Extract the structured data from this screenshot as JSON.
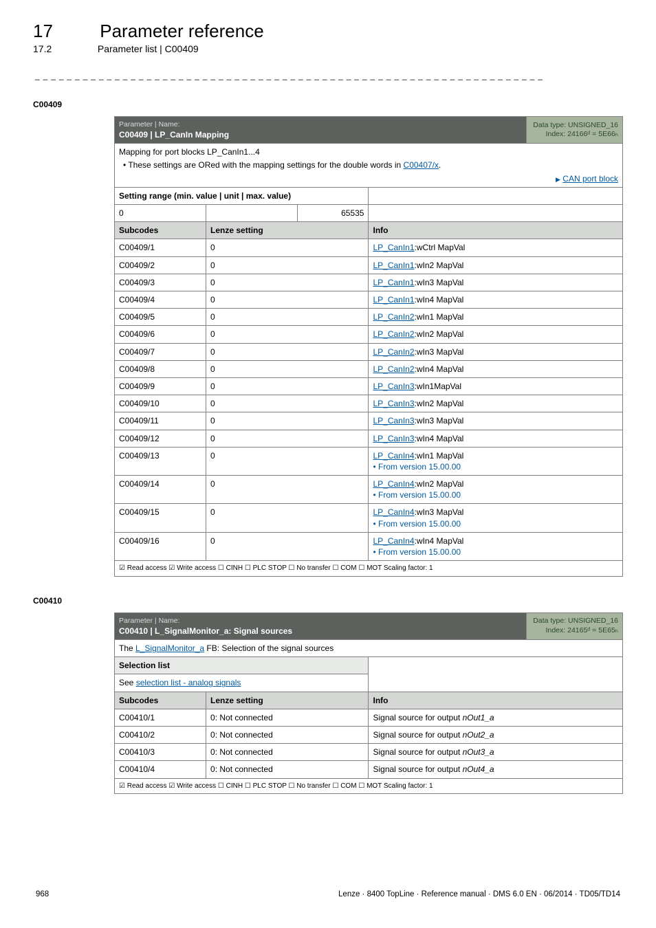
{
  "header": {
    "chapter_num": "17",
    "chapter_title": "Parameter reference",
    "section_num": "17.2",
    "section_title": "Parameter list | C00409"
  },
  "c409": {
    "code": "C00409",
    "param_label": "Parameter | Name:",
    "param_name": "C00409 | LP_CanIn Mapping",
    "dtype": "Data type: UNSIGNED_16",
    "index": "Index: 24166ᵈ = 5E66ₕ",
    "desc_line": "Mapping for port blocks LP_CanIn1...4",
    "desc_bullet_prefix": "• These settings are ORed with the mapping settings for the double words in ",
    "desc_bullet_link": "C00407/x",
    "desc_bullet_suffix": ".",
    "nav_link": "CAN port block",
    "setting_range_label": "Setting range (min. value | unit | max. value)",
    "min": "0",
    "max": "65535",
    "col_subcodes": "Subcodes",
    "col_lenze": "Lenze setting",
    "col_info": "Info",
    "rows": [
      {
        "sc": "C00409/1",
        "ls": "0",
        "info_link": "LP_CanIn1",
        "info_suffix": ":wCtrl MapVal"
      },
      {
        "sc": "C00409/2",
        "ls": "0",
        "info_link": "LP_CanIn1",
        "info_suffix": ":wIn2 MapVal"
      },
      {
        "sc": "C00409/3",
        "ls": "0",
        "info_link": "LP_CanIn1",
        "info_suffix": ":wIn3 MapVal"
      },
      {
        "sc": "C00409/4",
        "ls": "0",
        "info_link": "LP_CanIn1",
        "info_suffix": ":wIn4 MapVal"
      },
      {
        "sc": "C00409/5",
        "ls": "0",
        "info_link": "LP_CanIn2",
        "info_suffix": ":wIn1 MapVal"
      },
      {
        "sc": "C00409/6",
        "ls": "0",
        "info_link": "LP_CanIn2",
        "info_suffix": ":wIn2 MapVal"
      },
      {
        "sc": "C00409/7",
        "ls": "0",
        "info_link": "LP_CanIn2",
        "info_suffix": ":wIn3 MapVal"
      },
      {
        "sc": "C00409/8",
        "ls": "0",
        "info_link": "LP_CanIn2",
        "info_suffix": ":wIn4 MapVal"
      },
      {
        "sc": "C00409/9",
        "ls": "0",
        "info_link": "LP_CanIn3",
        "info_suffix": ":wIn1MapVal"
      },
      {
        "sc": "C00409/10",
        "ls": "0",
        "info_link": "LP_CanIn3",
        "info_suffix": ":wIn2 MapVal"
      },
      {
        "sc": "C00409/11",
        "ls": "0",
        "info_link": "LP_CanIn3",
        "info_suffix": ":wIn3 MapVal"
      },
      {
        "sc": "C00409/12",
        "ls": "0",
        "info_link": "LP_CanIn3",
        "info_suffix": ":wIn4 MapVal"
      },
      {
        "sc": "C00409/13",
        "ls": "0",
        "info_link": "LP_CanIn4",
        "info_suffix": ":wIn1 MapVal",
        "extra": "• From version 15.00.00"
      },
      {
        "sc": "C00409/14",
        "ls": "0",
        "info_link": "LP_CanIn4",
        "info_suffix": ":wIn2 MapVal",
        "extra": "• From version 15.00.00"
      },
      {
        "sc": "C00409/15",
        "ls": "0",
        "info_link": "LP_CanIn4",
        "info_suffix": ":wIn3 MapVal",
        "extra": "• From version 15.00.00"
      },
      {
        "sc": "C00409/16",
        "ls": "0",
        "info_link": "LP_CanIn4",
        "info_suffix": ":wIn4 MapVal",
        "extra": "• From version 15.00.00"
      }
    ],
    "footer": "☑ Read access   ☑ Write access   ☐ CINH   ☐ PLC STOP   ☐ No transfer   ☐ COM   ☐ MOT     Scaling factor: 1"
  },
  "c410": {
    "code": "C00410",
    "param_label": "Parameter | Name:",
    "param_name": "C00410 | L_SignalMonitor_a: Signal sources",
    "dtype": "Data type: UNSIGNED_16",
    "index": "Index: 24165ᵈ = 5E65ₕ",
    "desc_prefix": "The ",
    "desc_link": "L_SignalMonitor_a",
    "desc_suffix": " FB: Selection of the signal sources",
    "sel_list_label": "Selection list",
    "sel_list_link": "selection list - analog signals",
    "sel_list_prefix": "See ",
    "col_subcodes": "Subcodes",
    "col_lenze": "Lenze setting",
    "col_info": "Info",
    "rows": [
      {
        "sc": "C00410/1",
        "ls": "0: Not connected",
        "info_prefix": "Signal source for output ",
        "info_italic": "nOut1_a"
      },
      {
        "sc": "C00410/2",
        "ls": "0: Not connected",
        "info_prefix": "Signal source for output ",
        "info_italic": "nOut2_a"
      },
      {
        "sc": "C00410/3",
        "ls": "0: Not connected",
        "info_prefix": "Signal source for output ",
        "info_italic": "nOut3_a"
      },
      {
        "sc": "C00410/4",
        "ls": "0: Not connected",
        "info_prefix": "Signal source for output ",
        "info_italic": "nOut4_a"
      }
    ],
    "footer": "☑ Read access   ☑ Write access   ☐ CINH   ☐ PLC STOP   ☐ No transfer   ☐ COM   ☐ MOT     Scaling factor: 1"
  },
  "page_footer": {
    "page_num": "968",
    "doc_info": "Lenze · 8400 TopLine · Reference manual · DMS 6.0 EN · 06/2014 · TD05/TD14"
  }
}
